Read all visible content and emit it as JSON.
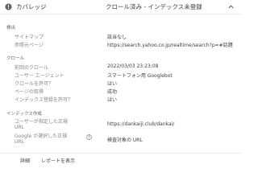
{
  "header": {
    "title": "カバレッジ",
    "status": "クロール済み - インデックス未登録"
  },
  "sections": {
    "detection": "検出",
    "crawl": "クロール",
    "indexing": "インデックス作成"
  },
  "rows": {
    "sitemap": {
      "label": "サイトマップ",
      "value": "該当なし"
    },
    "referring_page": {
      "label": "参照元ページ",
      "value": "https://search.yahoo.co.jp/realtime/search?p=#話題"
    },
    "last_crawl": {
      "label": "前回のクロール",
      "value": "2022/03/03 23:23:08"
    },
    "user_agent": {
      "label": "ユーザー エージェント",
      "value": "スマートフォン用 Googlebot"
    },
    "crawl_allowed": {
      "label": "クロールを許可？",
      "value": "はい"
    },
    "page_fetch": {
      "label": "ページの取得",
      "value": "成功"
    },
    "indexing_allowed": {
      "label": "インデックス登録を許可？",
      "value": "はい"
    },
    "user_canonical": {
      "label_line1": "ユーザーが指定した正規",
      "label_line2": "URL",
      "value": "https://dankaiji.club/dankai/"
    },
    "google_canonical": {
      "label_line1": "Google が選択した正規",
      "label_line2": "URL",
      "value": "検査対象の URL"
    }
  },
  "footer": {
    "details": "詳細",
    "report": "レポートを表示"
  },
  "colors": {
    "warning": "#5f6368",
    "text": "#3c4043",
    "muted": "#80868b"
  },
  "icons": {
    "status": "warning-icon",
    "collapse": "chevron-up-icon",
    "help": "help-icon"
  }
}
